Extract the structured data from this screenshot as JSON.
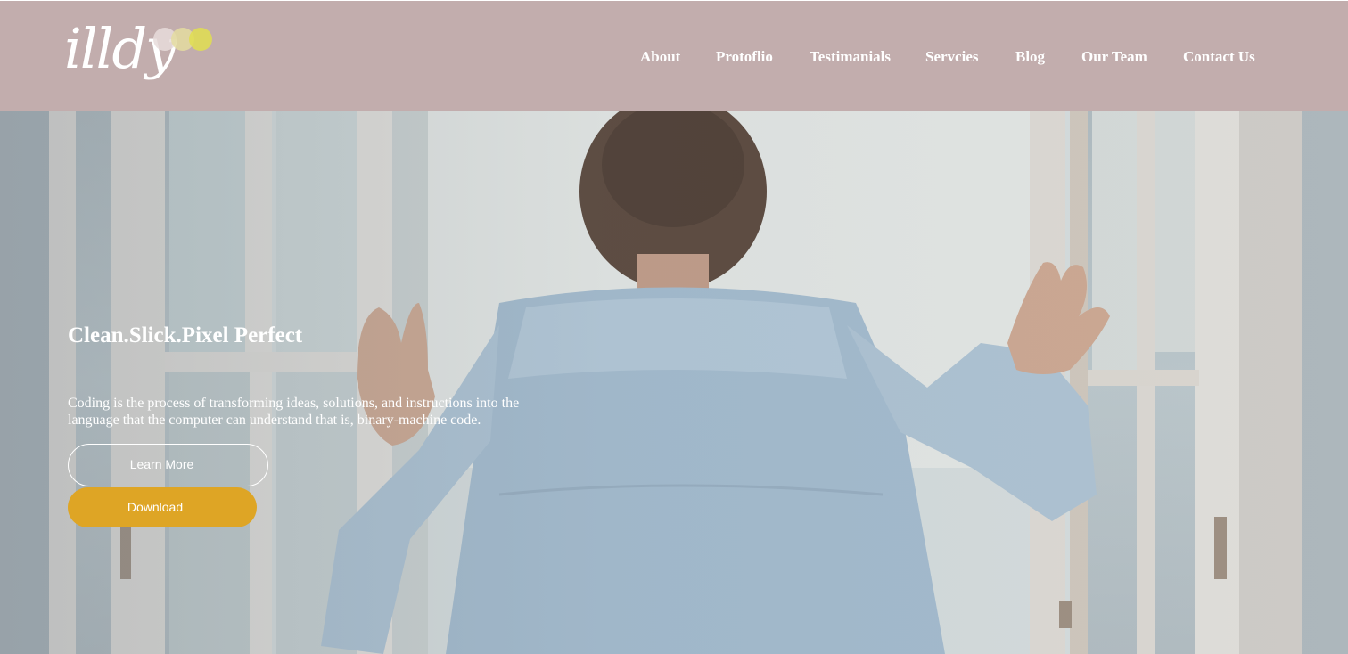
{
  "header": {
    "logo": {
      "text": "illdy",
      "dot_colors": [
        "#e8dcda",
        "#e4dca0",
        "#e0de50"
      ]
    },
    "background_color": "#c2adad",
    "nav": [
      {
        "label": "About"
      },
      {
        "label": "Protoflio"
      },
      {
        "label": "Testimanials"
      },
      {
        "label": "Servcies"
      },
      {
        "label": "Blog"
      },
      {
        "label": "Our Team"
      },
      {
        "label": "Contact Us"
      }
    ]
  },
  "hero": {
    "title": "Clean.Slick.Pixel Perfect",
    "description": "Coding is the process of transforming ideas, solutions, and instructions into the language that the computer can understand that is, binary-machine code.",
    "learn_more_label": "Learn More",
    "download_label": "Download",
    "download_color": "#dea525"
  }
}
